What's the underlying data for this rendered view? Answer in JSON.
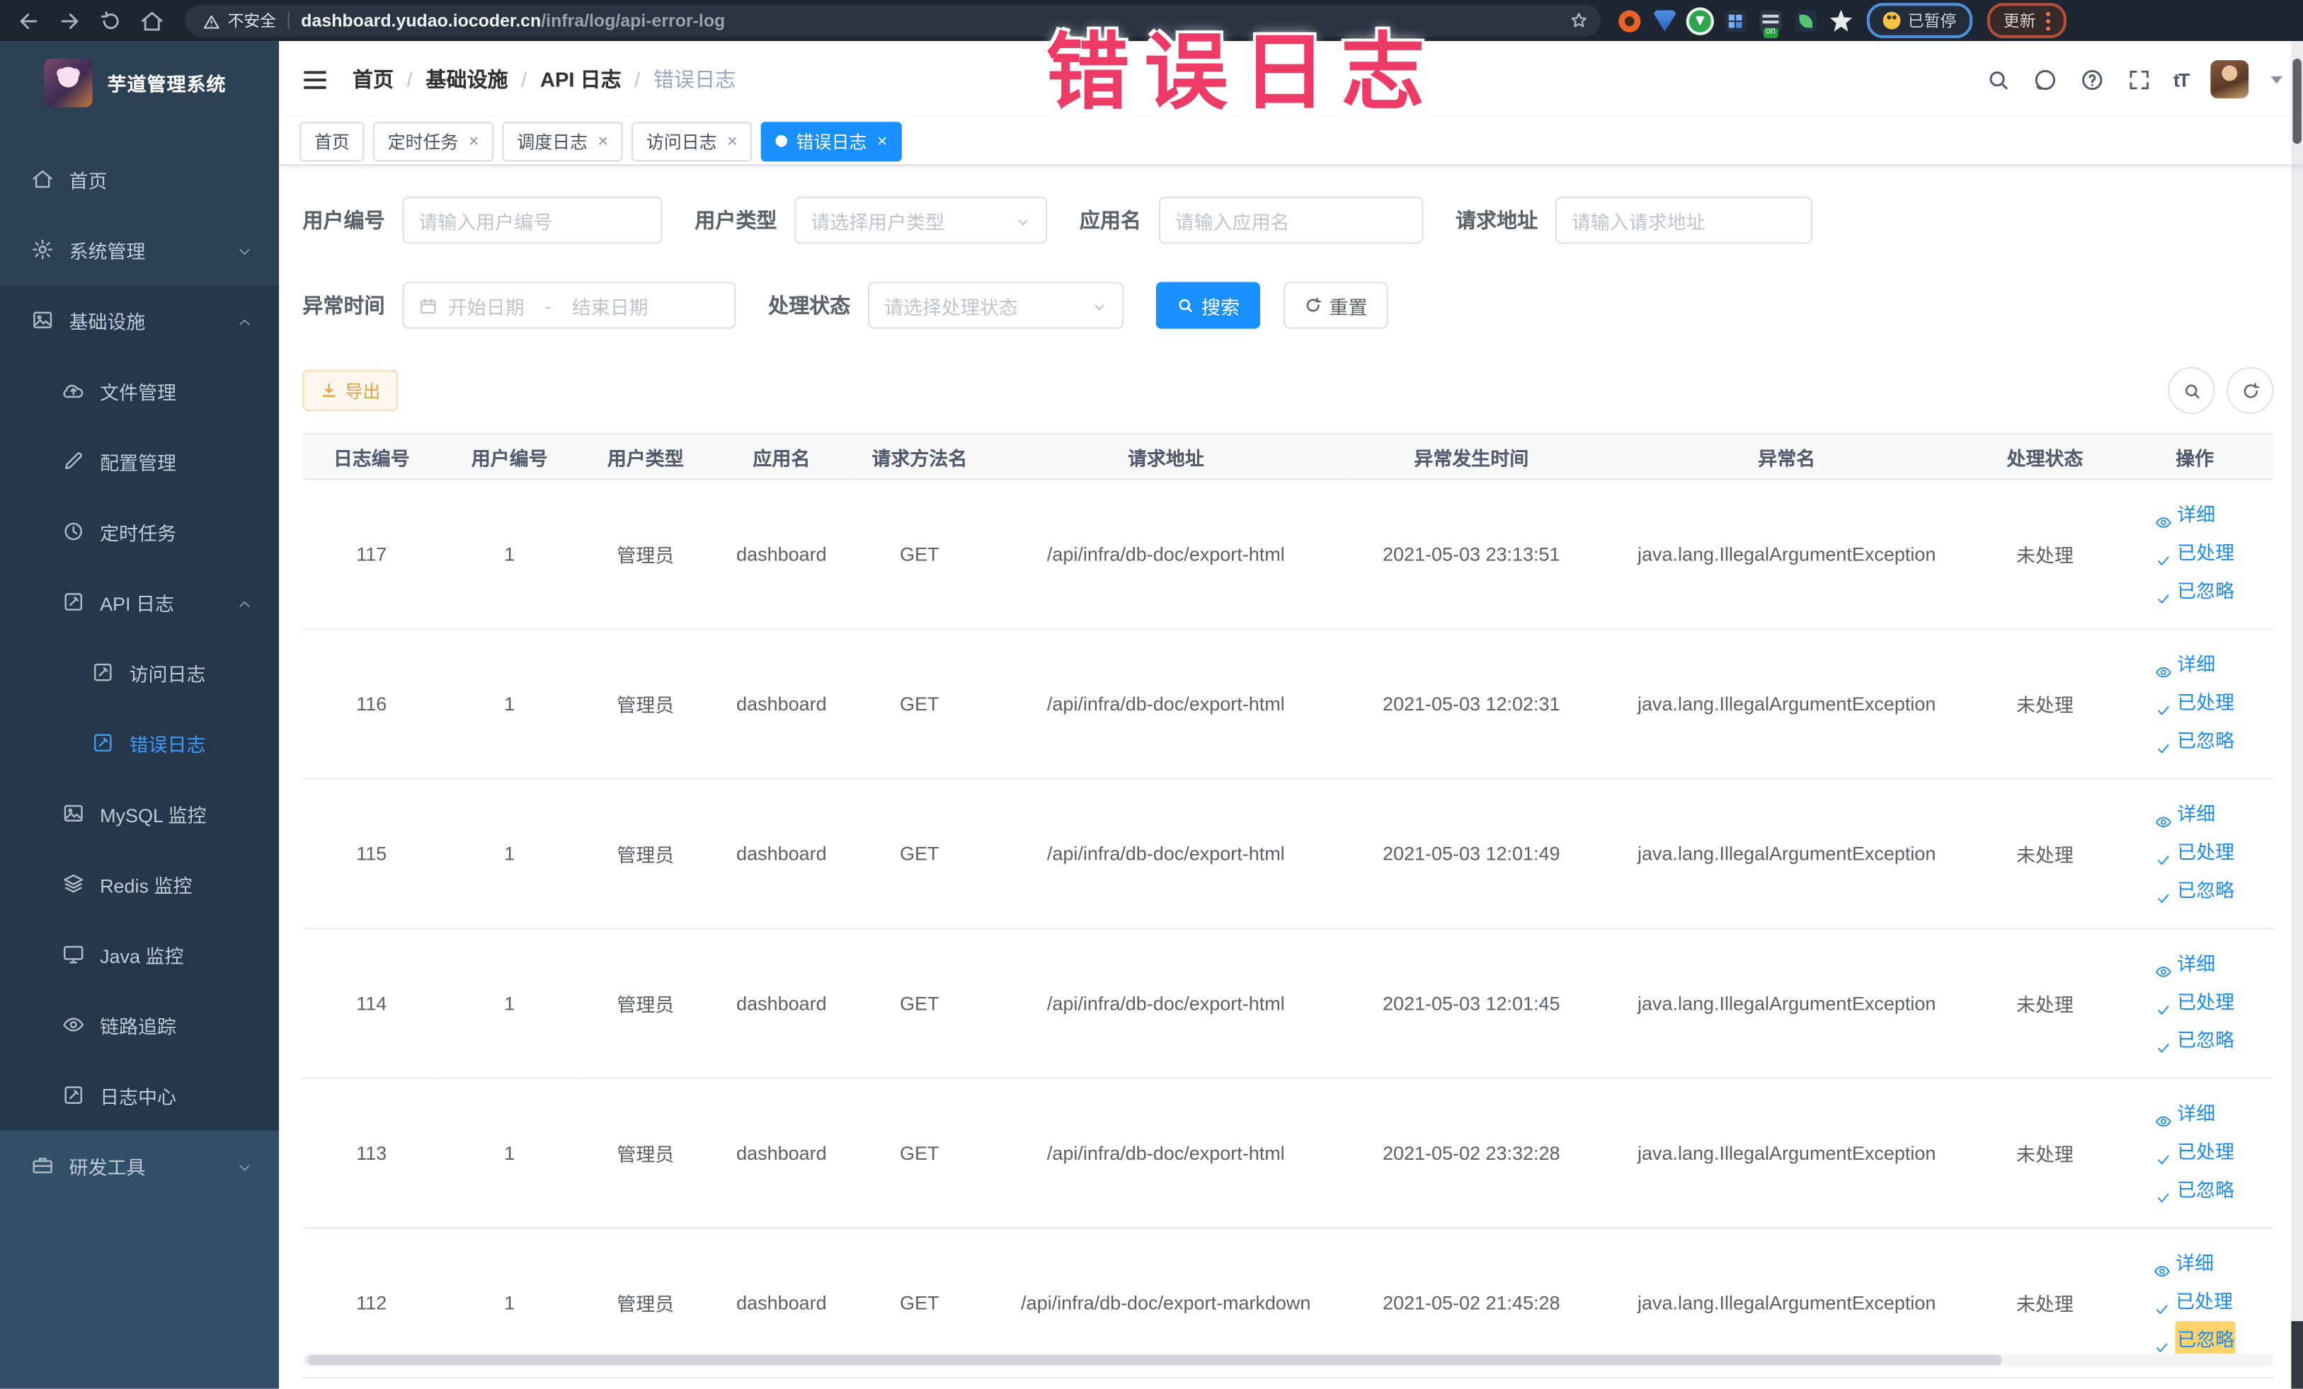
{
  "browser": {
    "security_label": "不安全",
    "url_host": "dashboard.yudao.iocoder.cn",
    "url_path": "/infra/log/api-error-log",
    "extension_badge": "on",
    "paused_label": "已暂停",
    "update_label": "更新"
  },
  "overlay": {
    "text": "错误日志",
    "color": "#ee3b66"
  },
  "sidebar": {
    "app_title": "芋道管理系统",
    "items": [
      {
        "name": "home",
        "label": "首页",
        "icon": "home-icon",
        "level": 0,
        "zone": "top"
      },
      {
        "name": "system-management",
        "label": "系统管理",
        "icon": "gear-icon",
        "level": 0,
        "chevron": "down",
        "zone": "top"
      },
      {
        "name": "infrastructure",
        "label": "基础设施",
        "icon": "picture-icon",
        "level": 0,
        "chevron": "up",
        "zone": "dark"
      },
      {
        "name": "file-management",
        "label": "文件管理",
        "icon": "cloud-upload-icon",
        "level": 1,
        "zone": "dark"
      },
      {
        "name": "config-management",
        "label": "配置管理",
        "icon": "edit-icon",
        "level": 1,
        "zone": "dark"
      },
      {
        "name": "scheduled-tasks",
        "label": "定时任务",
        "icon": "history-icon",
        "level": 1,
        "zone": "dark"
      },
      {
        "name": "api-log",
        "label": "API 日志",
        "icon": "edit-square-icon",
        "level": 1,
        "chevron": "up",
        "zone": "dark"
      },
      {
        "name": "access-log",
        "label": "访问日志",
        "icon": "edit-square-icon",
        "level": 2,
        "zone": "dark"
      },
      {
        "name": "error-log",
        "label": "错误日志",
        "icon": "edit-square-icon",
        "level": 2,
        "active": true,
        "zone": "dark"
      },
      {
        "name": "mysql-monitor",
        "label": "MySQL 监控",
        "icon": "image-icon",
        "level": 1,
        "zone": "dark"
      },
      {
        "name": "redis-monitor",
        "label": "Redis 监控",
        "icon": "layers-icon",
        "level": 1,
        "zone": "dark"
      },
      {
        "name": "java-monitor",
        "label": "Java 监控",
        "icon": "monitor-icon",
        "level": 1,
        "zone": "dark"
      },
      {
        "name": "trace",
        "label": "链路追踪",
        "icon": "eye-icon",
        "level": 1,
        "zone": "dark"
      },
      {
        "name": "log-center",
        "label": "日志中心",
        "icon": "edit-square-icon",
        "level": 1,
        "zone": "dark"
      },
      {
        "name": "dev-tools",
        "label": "研发工具",
        "icon": "toolbox-icon",
        "level": 0,
        "chevron": "down",
        "zone": "bottom"
      }
    ]
  },
  "header": {
    "breadcrumb": [
      "首页",
      "基础设施",
      "API 日志",
      "错误日志"
    ],
    "text_size_label": "tT"
  },
  "tabs": [
    {
      "name": "home",
      "label": "首页",
      "closable": false,
      "active": false
    },
    {
      "name": "scheduled-tasks",
      "label": "定时任务",
      "closable": true,
      "active": false
    },
    {
      "name": "dispatch-log",
      "label": "调度日志",
      "closable": true,
      "active": false
    },
    {
      "name": "access-log",
      "label": "访问日志",
      "closable": true,
      "active": false
    },
    {
      "name": "error-log",
      "label": "错误日志",
      "closable": true,
      "active": true
    }
  ],
  "filters": {
    "user_id": {
      "label": "用户编号",
      "placeholder": "请输入用户编号"
    },
    "user_type": {
      "label": "用户类型",
      "placeholder": "请选择用户类型"
    },
    "app_name": {
      "label": "应用名",
      "placeholder": "请输入应用名"
    },
    "request_url": {
      "label": "请求地址",
      "placeholder": "请输入请求地址"
    },
    "exception_time": {
      "label": "异常时间",
      "start_placeholder": "开始日期",
      "separator": "-",
      "end_placeholder": "结束日期"
    },
    "process_status": {
      "label": "处理状态",
      "placeholder": "请选择处理状态"
    },
    "search_label": "搜索",
    "reset_label": "重置"
  },
  "toolbar": {
    "export_label": "导出"
  },
  "table": {
    "columns": [
      "日志编号",
      "用户编号",
      "用户类型",
      "应用名",
      "请求方法名",
      "请求地址",
      "异常发生时间",
      "异常名",
      "处理状态",
      "操作"
    ],
    "action_labels": [
      "详细",
      "已处理",
      "已忽略"
    ],
    "rows": [
      {
        "id": "117",
        "user_id": "1",
        "user_type": "管理员",
        "app_name": "dashboard",
        "method": "GET",
        "url": "/api/infra/db-doc/export-html",
        "time": "2021-05-03 23:13:51",
        "exception": "java.lang.IllegalArgumentException",
        "status": "未处理"
      },
      {
        "id": "116",
        "user_id": "1",
        "user_type": "管理员",
        "app_name": "dashboard",
        "method": "GET",
        "url": "/api/infra/db-doc/export-html",
        "time": "2021-05-03 12:02:31",
        "exception": "java.lang.IllegalArgumentException",
        "status": "未处理"
      },
      {
        "id": "115",
        "user_id": "1",
        "user_type": "管理员",
        "app_name": "dashboard",
        "method": "GET",
        "url": "/api/infra/db-doc/export-html",
        "time": "2021-05-03 12:01:49",
        "exception": "java.lang.IllegalArgumentException",
        "status": "未处理"
      },
      {
        "id": "114",
        "user_id": "1",
        "user_type": "管理员",
        "app_name": "dashboard",
        "method": "GET",
        "url": "/api/infra/db-doc/export-html",
        "time": "2021-05-03 12:01:45",
        "exception": "java.lang.IllegalArgumentException",
        "status": "未处理"
      },
      {
        "id": "113",
        "user_id": "1",
        "user_type": "管理员",
        "app_name": "dashboard",
        "method": "GET",
        "url": "/api/infra/db-doc/export-html",
        "time": "2021-05-02 23:32:28",
        "exception": "java.lang.IllegalArgumentException",
        "status": "未处理"
      },
      {
        "id": "112",
        "user_id": "1",
        "user_type": "管理员",
        "app_name": "dashboard",
        "method": "GET",
        "url": "/api/infra/db-doc/export-markdown",
        "time": "2021-05-02 21:45:28",
        "exception": "java.lang.IllegalArgumentException",
        "status": "未处理",
        "ignore_highlighted": true
      }
    ]
  },
  "colors": {
    "accent": "#1890ff",
    "link": "#1a8bf8",
    "warning": "#e6a23c",
    "overlay_annotation": "#ee3b66",
    "sidebar_bg": "#2d4156",
    "sidebar_submenu_bg": "#24374b",
    "sidebar_bottom_bg": "#325069",
    "active_menu_text": "#3f9bfa"
  }
}
